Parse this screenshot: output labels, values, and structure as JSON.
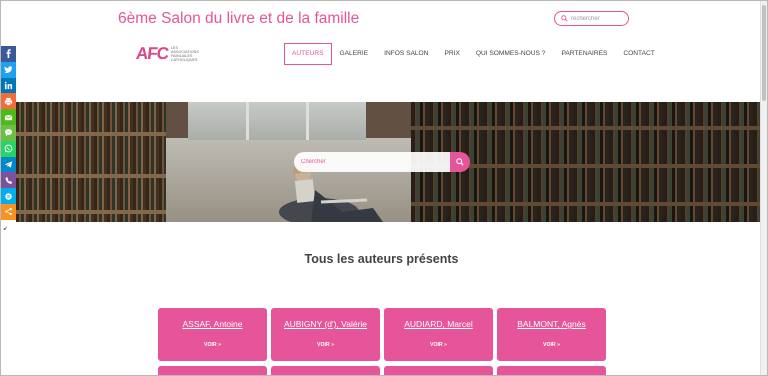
{
  "site": {
    "title": "6ème Salon du livre et de la famille",
    "search_placeholder": "rechercher"
  },
  "logo": {
    "mark": "AFC",
    "lines": [
      "LES",
      "ASSOCIATIONS",
      "FAMILIALES",
      "CATHOLIQUES"
    ]
  },
  "nav": {
    "items": [
      {
        "label": "AUTEURS",
        "active": true
      },
      {
        "label": "GALERIE",
        "active": false
      },
      {
        "label": "INFOS SALON",
        "active": false
      },
      {
        "label": "PRIX",
        "active": false
      },
      {
        "label": "QUI SOMMES-NOUS ?",
        "active": false
      },
      {
        "label": "PARTENAIRES",
        "active": false
      },
      {
        "label": "CONTACT",
        "active": false
      }
    ]
  },
  "share": {
    "buttons": [
      {
        "icon": "facebook-icon",
        "color": "#3b5998"
      },
      {
        "icon": "twitter-icon",
        "color": "#1da1f2"
      },
      {
        "icon": "linkedin-icon",
        "color": "#0077b5"
      },
      {
        "icon": "print-icon",
        "color": "#f36c3d"
      },
      {
        "icon": "email-icon",
        "color": "#4cbb17"
      },
      {
        "icon": "sms-icon",
        "color": "#6cbe45"
      },
      {
        "icon": "whatsapp-icon",
        "color": "#25d366"
      },
      {
        "icon": "telegram-icon",
        "color": "#0088cc"
      },
      {
        "icon": "viber-icon",
        "color": "#7c529e"
      },
      {
        "icon": "skype-icon",
        "color": "#00aff0"
      },
      {
        "icon": "share-icon",
        "color": "#f7931e"
      }
    ]
  },
  "hero": {
    "search_placeholder": "Chercher"
  },
  "main": {
    "heading": "Tous les auteurs présents",
    "authors": [
      {
        "name": "ASSAF, Antoine",
        "link": "VOIR »"
      },
      {
        "name": "AUBIGNY (d'), Valérie",
        "link": "VOIR »"
      },
      {
        "name": "AUDIARD, Marcel",
        "link": "VOIR »"
      },
      {
        "name": "BALMONT, Agnès",
        "link": "VOIR »"
      }
    ]
  },
  "colors": {
    "accent": "#e6549a"
  }
}
